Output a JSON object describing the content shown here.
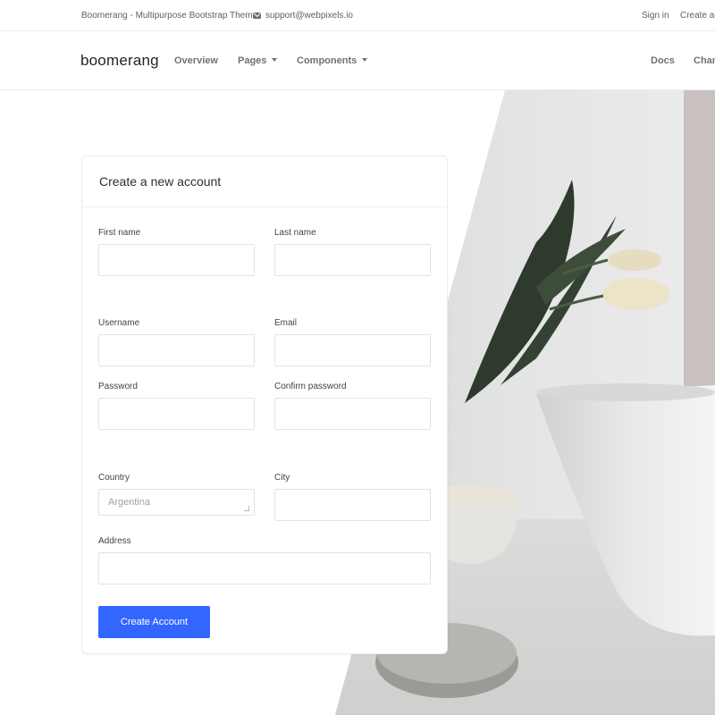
{
  "topbar": {
    "site_title": "Boomerang - Multipurpose Bootstrap Theme",
    "email": "support@webpixels.io",
    "sign_in": "Sign in",
    "create_account": "Create ac"
  },
  "navbar": {
    "logo": "boomerang",
    "items": [
      {
        "label": "Overview"
      },
      {
        "label": "Pages"
      },
      {
        "label": "Components"
      },
      {
        "label": "Docs"
      },
      {
        "label": "Chan"
      }
    ]
  },
  "form": {
    "title": "Create a new account",
    "fields": {
      "first_name": {
        "label": "First name",
        "value": ""
      },
      "last_name": {
        "label": "Last name",
        "value": ""
      },
      "username": {
        "label": "Username",
        "value": ""
      },
      "email": {
        "label": "Email",
        "value": ""
      },
      "password": {
        "label": "Password",
        "value": ""
      },
      "confirm_password": {
        "label": "Confirm password",
        "value": ""
      },
      "country": {
        "label": "Country",
        "value": "Argentina"
      },
      "city": {
        "label": "City",
        "value": ""
      },
      "address": {
        "label": "Address",
        "value": ""
      }
    },
    "submit_label": "Create Account"
  },
  "colors": {
    "accent": "#3366ff",
    "text_dark": "#2b3035",
    "muted": "#6c737a"
  },
  "icons": [
    "mail-icon",
    "caret-down-icon"
  ]
}
